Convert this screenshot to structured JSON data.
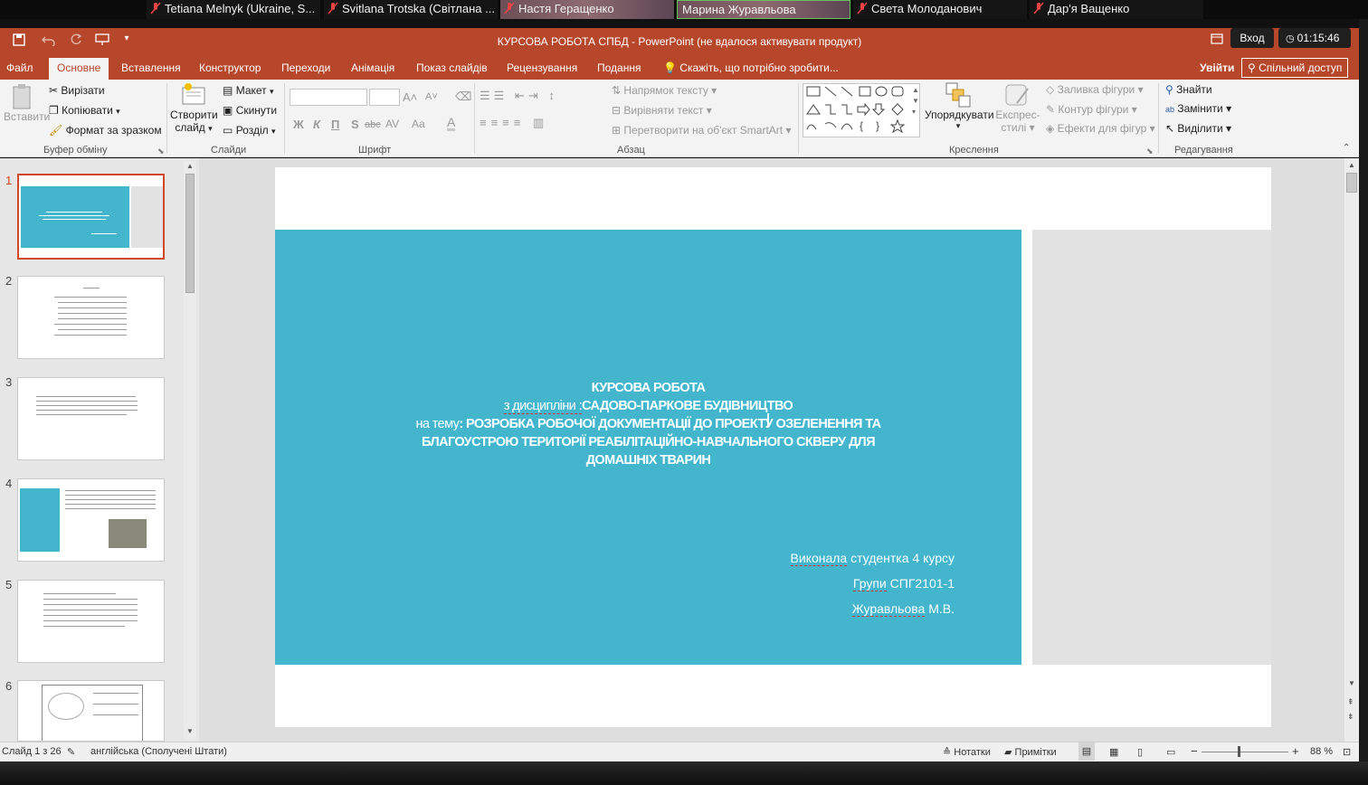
{
  "video_participants": [
    {
      "name": "Tetiana Melnyk (Ukraine, S..."
    },
    {
      "name": "Svitlana Trotska (Світлана ..."
    },
    {
      "name": "Настя Геращенко"
    },
    {
      "name": "Марина Журавльова"
    },
    {
      "name": "Света Молоданович"
    },
    {
      "name": "Дар'я Ващенко"
    }
  ],
  "window": {
    "title": "КУРСОВА РОБОТА СПБД - PowerPoint (не вдалося активувати продукт)",
    "login_label": "Вход",
    "timer": "01:15:46"
  },
  "tabs": {
    "items": [
      "Файл",
      "Основне",
      "Вставлення",
      "Конструктор",
      "Переходи",
      "Анімація",
      "Показ слайдів",
      "Рецензування",
      "Подання"
    ],
    "active": "Основне",
    "tell_me": "Скажіть, що потрібно зробити...",
    "sign_in": "Увійти",
    "share": "Спільний доступ"
  },
  "ribbon": {
    "clipboard": {
      "paste": "Вставити",
      "cut": "Вирізати",
      "copy": "Копіювати",
      "format_painter": "Формат за зразком",
      "group": "Буфер обміну"
    },
    "slides": {
      "new_slide_1": "Створити",
      "new_slide_2": "слайд",
      "layout": "Макет",
      "reset": "Скинути",
      "section": "Розділ",
      "group": "Слайди"
    },
    "font": {
      "group": "Шрифт",
      "bold": "Ж",
      "italic": "К",
      "underline": "П",
      "strike": "S",
      "strike2": "abc",
      "spacing": "AV",
      "case": "Aa",
      "color": "A",
      "grow": "A",
      "shrink": "A"
    },
    "paragraph": {
      "text_direction": "Напрямок тексту",
      "align_text": "Вирівняти текст",
      "smartart": "Перетворити на об'єкт SmartArt",
      "group": "Абзац"
    },
    "drawing": {
      "arrange": "Упорядкувати",
      "quick_styles_1": "Експрес-",
      "quick_styles_2": "стилі",
      "shape_fill": "Заливка фігури",
      "shape_outline": "Контур фігури",
      "shape_effects": "Ефекти для фігур",
      "group": "Креслення"
    },
    "editing": {
      "find": "Знайти",
      "replace": "Замінити",
      "select": "Виділити",
      "group": "Редагування"
    }
  },
  "thumbnails": [
    "1",
    "2",
    "3",
    "4",
    "5",
    "6"
  ],
  "slide": {
    "line1": "КУРСОВА РОБОТА",
    "line2a": "з дисципліни :",
    "line2b": "САДОВО-ПАРКОВЕ БУДІВНИЦТВО",
    "line3a": "на тему",
    "line3b": ": РОЗРОБКА РОБОЧОЇ ДОКУМЕНТАЦІЇ ДО ПРОЕКТУ ОЗЕЛЕНЕННЯ ТА",
    "line4": "БЛАГОУСТРОЮ ТЕРИТОРІЇ РЕАБІЛІТАЦІЙНО-НАВЧАЛЬНОГО СКВЕРУ ДЛЯ",
    "line5": "ДОМАШНІХ ТВАРИН",
    "author1a": "Виконала",
    "author1b": " студентка 4 курсу",
    "author2a": "Групи",
    "author2b": " СПГ2101-1",
    "author3a": "Журавльова",
    "author3b": " М.В."
  },
  "status": {
    "slide_counter": "Слайд 1 з 26",
    "language": "англійська (Сполучені Штати)",
    "notes": "Нотатки",
    "comments": "Примітки",
    "zoom": "88 %"
  },
  "colors": {
    "accent": "#b7472a",
    "slide_band": "#43b6ce",
    "selected_thumb": "#d24726"
  }
}
